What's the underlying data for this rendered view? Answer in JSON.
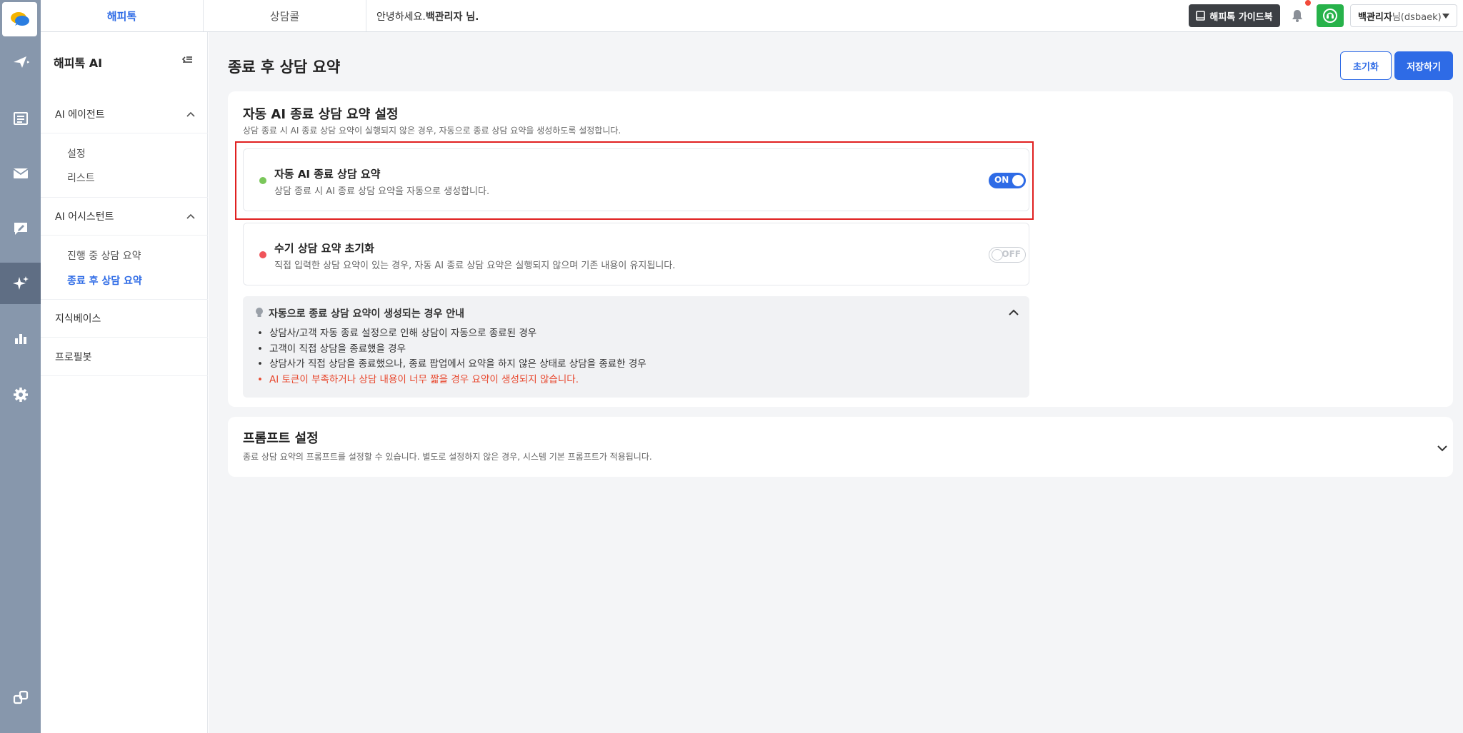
{
  "topbar": {
    "tabs": [
      {
        "label": "해피톡",
        "active": true
      },
      {
        "label": "상담콜",
        "active": false
      }
    ],
    "greeting_prefix": "안녕하세요.",
    "greeting_name": "백관리자 님.",
    "guide_label": "해피톡 가이드북",
    "user_name": "백관리자",
    "user_suffix": "님(dsbaek)"
  },
  "rail": {
    "icons": [
      "chat-logo-icon",
      "send-icon",
      "list-icon",
      "mail-icon",
      "comment-edit-icon",
      "ai-sparkle-icon",
      "chart-icon",
      "gear-icon",
      "link-icon"
    ],
    "active": "ai-sparkle-icon"
  },
  "sidebar": {
    "title": "해피톡 AI",
    "groups": [
      {
        "label": "AI 에이전트",
        "items": [
          "설정",
          "리스트"
        ]
      },
      {
        "label": "AI 어시스턴트",
        "items": [
          "진행 중 상담 요약",
          "종료 후 상담 요약"
        ]
      },
      {
        "label": "지식베이스",
        "items": []
      },
      {
        "label": "프로필봇",
        "items": []
      }
    ],
    "active_item": "종료 후 상담 요약"
  },
  "main": {
    "page_title": "종료 후 상담 요약",
    "reset_label": "초기화",
    "save_label": "저장하기",
    "auto_section": {
      "title": "자동 AI 종료 상담 요약 설정",
      "description": "상담 종료 시 AI 종료 상담 요약이 실행되지 않은 경우, 자동으로 종료 상담 요약을 생성하도록 설정합니다.",
      "settings": [
        {
          "title": "자동 AI 종료 상담 요약",
          "description": "상담 종료 시 AI 종료 상담 요약을 자동으로 생성합니다.",
          "state": "ON",
          "dot_color": "#7ac75a"
        },
        {
          "title": "수기 상담 요약 초기화",
          "description": "직접 입력한 상담 요약이 있는 경우, 자동 AI 종료 상담 요약은 실행되지 않으며 기존 내용이 유지됩니다.",
          "state": "OFF",
          "dot_color": "#f0545a"
        }
      ],
      "info": {
        "title": "자동으로 종료 상담 요약이 생성되는 경우 안내",
        "items": [
          "상담사/고객 자동 종료 설정으로 인해 상담이 자동으로 종료된 경우",
          "고객이 직접 상담을 종료했을 경우",
          "상담사가 직접 상담을 종료했으나, 종료 팝업에서 요약을 하지 않은 상태로 상담을 종료한 경우"
        ],
        "warning": "AI 토큰이 부족하거나 상담 내용이 너무 짧을 경우 요약이 생성되지 않습니다."
      }
    },
    "prompt_section": {
      "title": "프롬프트 설정",
      "description": "종료 상담 요약의 프롬프트를 설정할 수 있습니다. 별도로 설정하지 않은 경우, 시스템 기본 프롬프트가 적용됩니다."
    }
  },
  "colors": {
    "accent": "#2e6be6",
    "rail": "#8797ac",
    "highlight": "#e02020",
    "warning_text": "#e8482e"
  }
}
